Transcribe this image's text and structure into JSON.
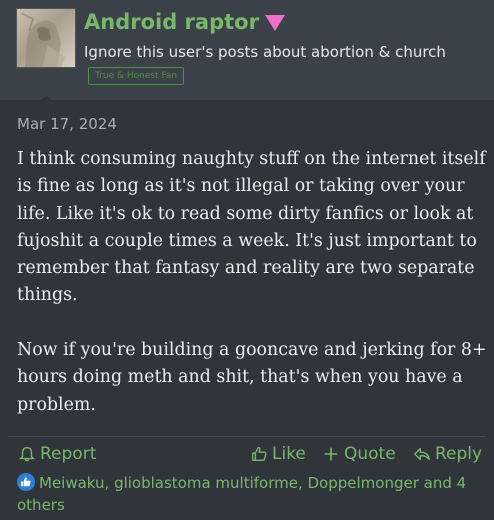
{
  "post": {
    "username": "Android raptor",
    "user_title": "Ignore this user's posts about abortion & church",
    "badge": "True & Honest Fan",
    "date": "Mar 17, 2024",
    "paragraphs": [
      "I think consuming naughty stuff on the internet itself is fine as long as it's not illegal or taking over your life. Like it's ok to read some dirty fanfics or look at fujoshit a couple times a week. It's just important to remember that fantasy and reality are two separate things.",
      "Now if you're building a gooncave and jerking for 8+ hours doing meth and shit, that's when you have a problem."
    ]
  },
  "actions": {
    "report": "Report",
    "like": "Like",
    "quote": "Quote",
    "reply": "Reply"
  },
  "reactions": {
    "text": "Meiwaku, glioblastoma multiforme, Doppelmonger and 4 others",
    "icon": "thumbs-up-icon"
  },
  "colors": {
    "accent_green": "#79b86a",
    "badge_pink": "#f06fc8",
    "background": "#2f353b",
    "header_bg": "#3a4148",
    "like_blue": "#2f7fd6"
  }
}
